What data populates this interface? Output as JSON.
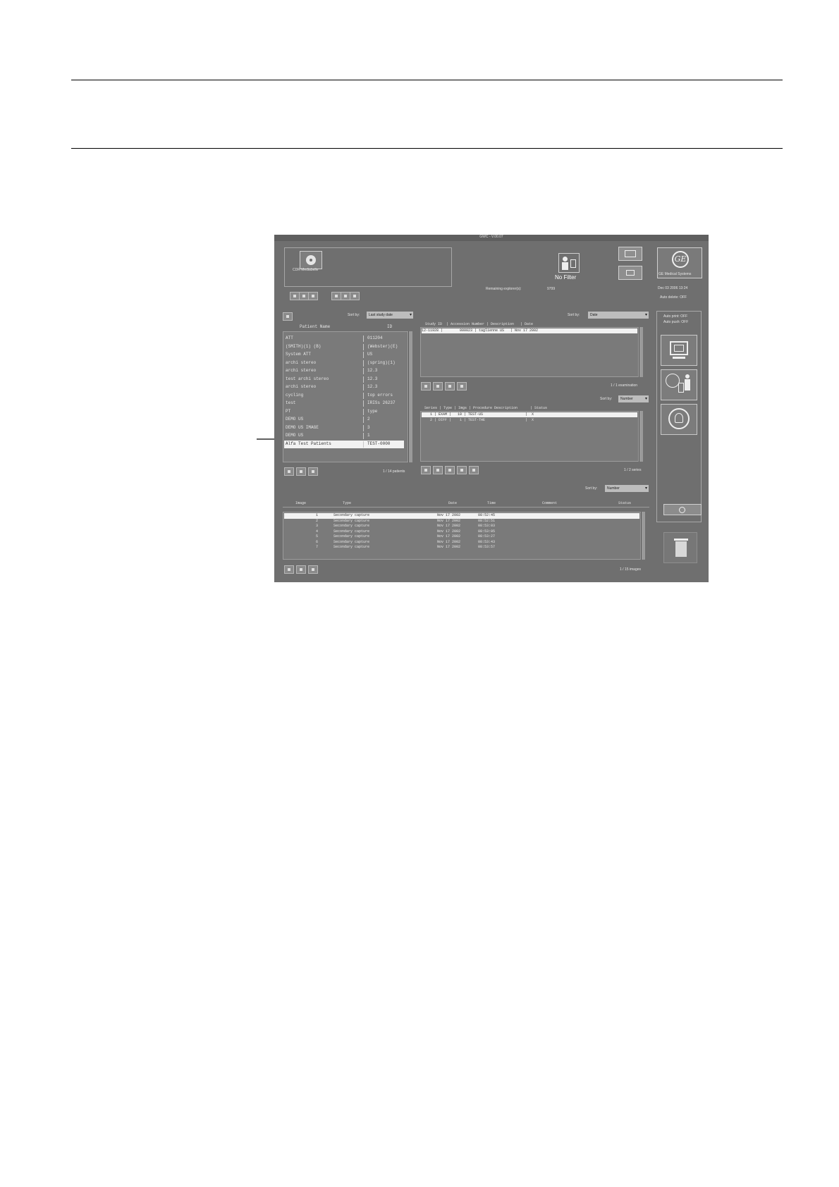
{
  "screen": {
    "window_title": "GWC - V.00.07",
    "cdr_label": "CDR Mediabelle",
    "no_filter_label": "No Filter",
    "remaining_label": "Remaining explorer(s):",
    "remaining_value": "9799",
    "brand_label": "GE Medical Systems",
    "datetime": "Dec 03 2006 13:24",
    "auto_delete": "Auto delete: OFF",
    "auto_print": "Auto print: OFF",
    "auto_push": "Auto push: OFF",
    "patients": {
      "sort_label": "Sort by:",
      "sort_value": "Last study date",
      "col_name": "Patient Name",
      "col_id": "ID",
      "rows": [
        {
          "name": "ATT",
          "id": "011204"
        },
        {
          "name": "(SMITH)(1) (B)",
          "id": "(Webster)(E)"
        },
        {
          "name": "System ATT",
          "id": "US"
        },
        {
          "name": "archi stereo",
          "id": "(spring)(1)"
        },
        {
          "name": "archi stereo",
          "id": "12.3"
        },
        {
          "name": "test archi stereo",
          "id": "12.3"
        },
        {
          "name": "archi stereo",
          "id": "12.3"
        },
        {
          "name": "cycling",
          "id": "top errors"
        },
        {
          "name": "test",
          "id": "IRISs 26237"
        },
        {
          "name": "PT",
          "id": "type"
        },
        {
          "name": "DEMO US",
          "id": "2"
        },
        {
          "name": "DEMO US IMAGE",
          "id": "3"
        },
        {
          "name": "DEMO US",
          "id": "1"
        },
        {
          "name": "Alfa Test Patients",
          "id": "TEST-0000"
        }
      ],
      "count": "1 / 14 patients"
    },
    "exams": {
      "sort_label": "Sort by:",
      "sort_value": "Date",
      "header": "Study ID  | Accession Number | Description   | Date",
      "rows": [
        "12-11928 |        000023 | taglienne US   | Nov 17 2002"
      ],
      "count": "1 / 1 examination"
    },
    "series": {
      "sort_label": "Sort by:",
      "sort_value": "Number",
      "header": "Series | Type | Imgs | Procedure Description      | Status",
      "rows": [
        "    1 | EXAM |   10 | TEST-US                    |  X",
        "    2 | DIFF |    1 | TEST-THE                   |  X"
      ],
      "count": "1 / 2 series"
    },
    "images": {
      "sort_label": "Sort by:",
      "sort_value": "Number",
      "col_image": "Image",
      "col_type": "Type",
      "col_date": "Date",
      "col_time": "Time",
      "col_comment": "Comment",
      "col_status": "Status",
      "rows": [
        {
          "image": "1",
          "type": "Secondary capture",
          "date": "Nov 17 2002",
          "time": "08:52:45"
        },
        {
          "image": "2",
          "type": "Secondary capture",
          "date": "Nov 17 2002",
          "time": "08:52:51"
        },
        {
          "image": "3",
          "type": "Secondary capture",
          "date": "Nov 17 2002",
          "time": "08:53:03"
        },
        {
          "image": "4",
          "type": "Secondary capture",
          "date": "Nov 17 2002",
          "time": "08:53:05"
        },
        {
          "image": "5",
          "type": "Secondary capture",
          "date": "Nov 17 2002",
          "time": "08:53:27"
        },
        {
          "image": "6",
          "type": "Secondary capture",
          "date": "Nov 17 2002",
          "time": "08:53:43"
        },
        {
          "image": "7",
          "type": "Secondary capture",
          "date": "Nov 17 2002",
          "time": "08:53:57"
        }
      ],
      "count": "1 / 15 images"
    }
  }
}
